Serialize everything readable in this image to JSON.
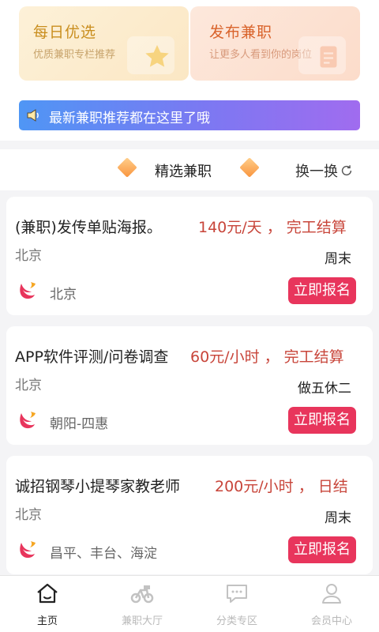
{
  "promo_cards": [
    {
      "title": "每日优选",
      "subtitle": "优质兼职专栏推荐",
      "icon": "star-icon"
    },
    {
      "title": "发布兼职",
      "subtitle": "让更多人看到你的岗位",
      "icon": "document-icon"
    }
  ],
  "notice": {
    "icon": "speaker-icon",
    "text": "最新兼职推荐都在这里了哦"
  },
  "section": {
    "title": "精选兼职",
    "refresh_label": "换一换"
  },
  "jobs": [
    {
      "title": "(兼职)发传单贴海报。",
      "salary": "140元/天 ， 完工结算",
      "city": "北京",
      "schedule": "周末",
      "location": "北京",
      "apply_label": "立即报名"
    },
    {
      "title": "APP软件评测/问卷调查",
      "salary": "60元/小时 ， 完工结算",
      "city": "北京",
      "schedule": "做五休二",
      "location": "朝阳-四惠",
      "apply_label": "立即报名"
    },
    {
      "title": "诚招钢琴小提琴家教老师",
      "salary": "200元/小时 ， 日结",
      "city": "北京",
      "schedule": "周末",
      "location": "昌平、丰台、海淀",
      "apply_label": "立即报名"
    }
  ],
  "bottom_nav": [
    {
      "label": "主页",
      "icon": "home-icon",
      "active": true
    },
    {
      "label": "兼职大厅",
      "icon": "bike-icon",
      "active": false
    },
    {
      "label": "分类专区",
      "icon": "chat-icon",
      "active": false
    },
    {
      "label": "会员中心",
      "icon": "user-icon",
      "active": false
    }
  ],
  "colors": {
    "accent_red": "#e8355c",
    "salary_red": "#c8453a",
    "notice_start": "#4f96f5",
    "notice_end": "#a06cef",
    "daily_title": "#c98e1e",
    "post_title": "#d9632b"
  }
}
